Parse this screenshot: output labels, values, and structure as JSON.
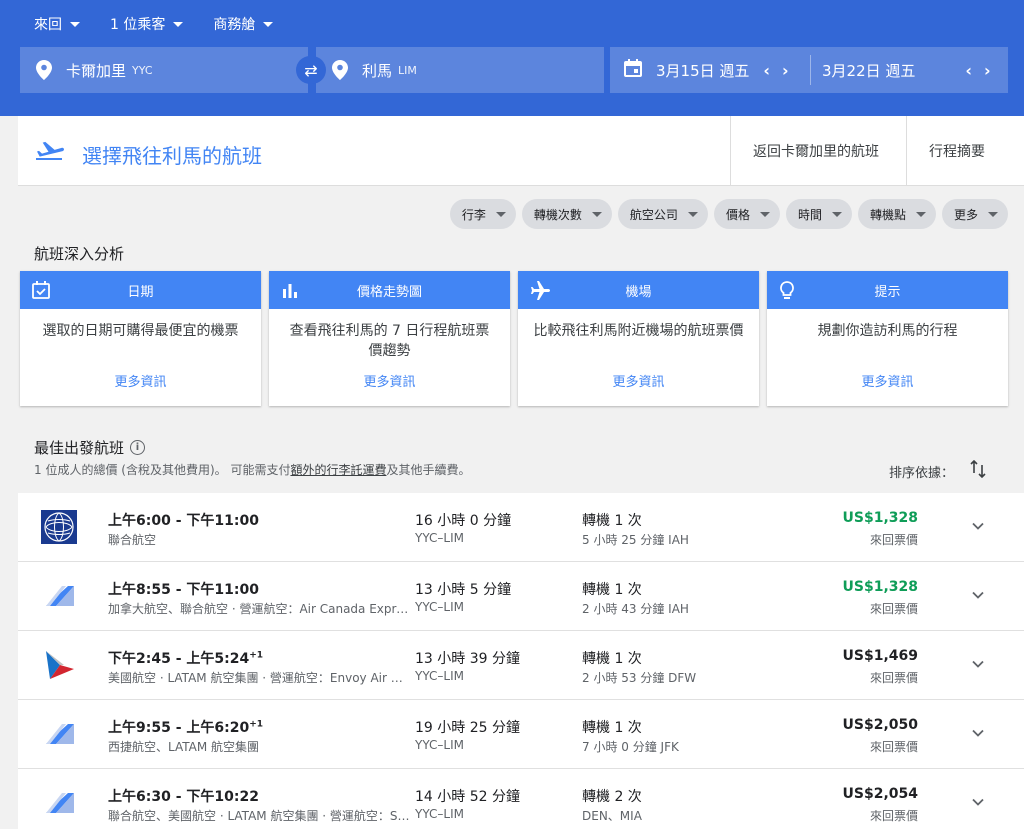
{
  "top_options": {
    "trip_type": "來回",
    "passengers": "1 位乘客",
    "cabin": "商務艙"
  },
  "search": {
    "origin": "卡爾加里",
    "origin_code": "YYC",
    "destination": "利馬",
    "destination_code": "LIM",
    "depart_date": "3月15日 週五",
    "return_date": "3月22日 週五"
  },
  "header": {
    "title": "選擇飛往利馬的航班",
    "crumb_return": "返回卡爾加里的航班",
    "crumb_summary": "行程摘要"
  },
  "filters": [
    "行李",
    "轉機次數",
    "航空公司",
    "價格",
    "時間",
    "轉機點",
    "更多"
  ],
  "insights": {
    "title": "航班深入分析",
    "cards": [
      {
        "icon": "calendar-check-icon",
        "title": "日期",
        "body": "選取的日期可購得最便宜的機票",
        "link": "更多資訊"
      },
      {
        "icon": "bar-chart-icon",
        "title": "價格走勢圖",
        "body": "查看飛往利馬的 7 日行程航班票價趨勢",
        "link": "更多資訊"
      },
      {
        "icon": "airplane-icon",
        "title": "機場",
        "body": "比較飛往利馬附近機場的航班票價",
        "link": "更多資訊"
      },
      {
        "icon": "lightbulb-icon",
        "title": "提示",
        "body": "規劃你造訪利馬的行程",
        "link": "更多資訊"
      }
    ]
  },
  "best": {
    "title": "最佳出發航班",
    "note_pre": "1 位成人的總價 (含稅及其他費用)。 可能需支付",
    "note_link": "額外的行李託運費",
    "note_post": "及其他手續費。",
    "sort_label": "排序依據："
  },
  "flights": [
    {
      "logo": "united",
      "times": "上午6:00 - 下午11:00",
      "plus": "",
      "airline": "聯合航空",
      "duration": "16 小時 0 分鐘",
      "route": "YYC–LIM",
      "stops": "轉機 1 次",
      "stop_info": "5 小時 25 分鐘 IAH",
      "price": "US$1,328",
      "price_type": "來回票價",
      "cheap": true
    },
    {
      "logo": "generic",
      "times": "上午8:55 - 下午11:00",
      "plus": "",
      "airline": "加拿大航空、聯合航空 · 營運航空：Air Canada Express - Jazz",
      "duration": "13 小時 5 分鐘",
      "route": "YYC–LIM",
      "stops": "轉機 1 次",
      "stop_info": "2 小時 43 分鐘 IAH",
      "price": "US$1,328",
      "price_type": "來回票價",
      "cheap": true
    },
    {
      "logo": "american",
      "times": "下午2:45 - 上午5:24",
      "plus": "+1",
      "airline": "美國航空 · LATAM 航空集團 · 營運航空：Envoy Air as American Eagle",
      "duration": "13 小時 39 分鐘",
      "route": "YYC–LIM",
      "stops": "轉機 1 次",
      "stop_info": "2 小時 53 分鐘 DFW",
      "price": "US$1,469",
      "price_type": "來回票價",
      "cheap": false
    },
    {
      "logo": "generic",
      "times": "上午9:55 - 上午6:20",
      "plus": "+1",
      "airline": "西捷航空、LATAM 航空集團",
      "duration": "19 小時 25 分鐘",
      "route": "YYC–LIM",
      "stops": "轉機 1 次",
      "stop_info": "7 小時 0 分鐘 JFK",
      "price": "US$2,050",
      "price_type": "來回票價",
      "cheap": false
    },
    {
      "logo": "generic",
      "times": "上午6:30 - 下午10:22",
      "plus": "",
      "airline": "聯合航空、美國航空 · LATAM 航空集團 · 營運航空：SkyWest",
      "duration": "14 小時 52 分鐘",
      "route": "YYC–LIM",
      "stops": "轉機 2 次",
      "stop_info": "DEN、MIA",
      "price": "US$2,054",
      "price_type": "來回票價",
      "cheap": false
    }
  ],
  "colors": {
    "brand_blue": "#3367d6",
    "accent_blue": "#4285f4",
    "price_green": "#0f9d58"
  }
}
